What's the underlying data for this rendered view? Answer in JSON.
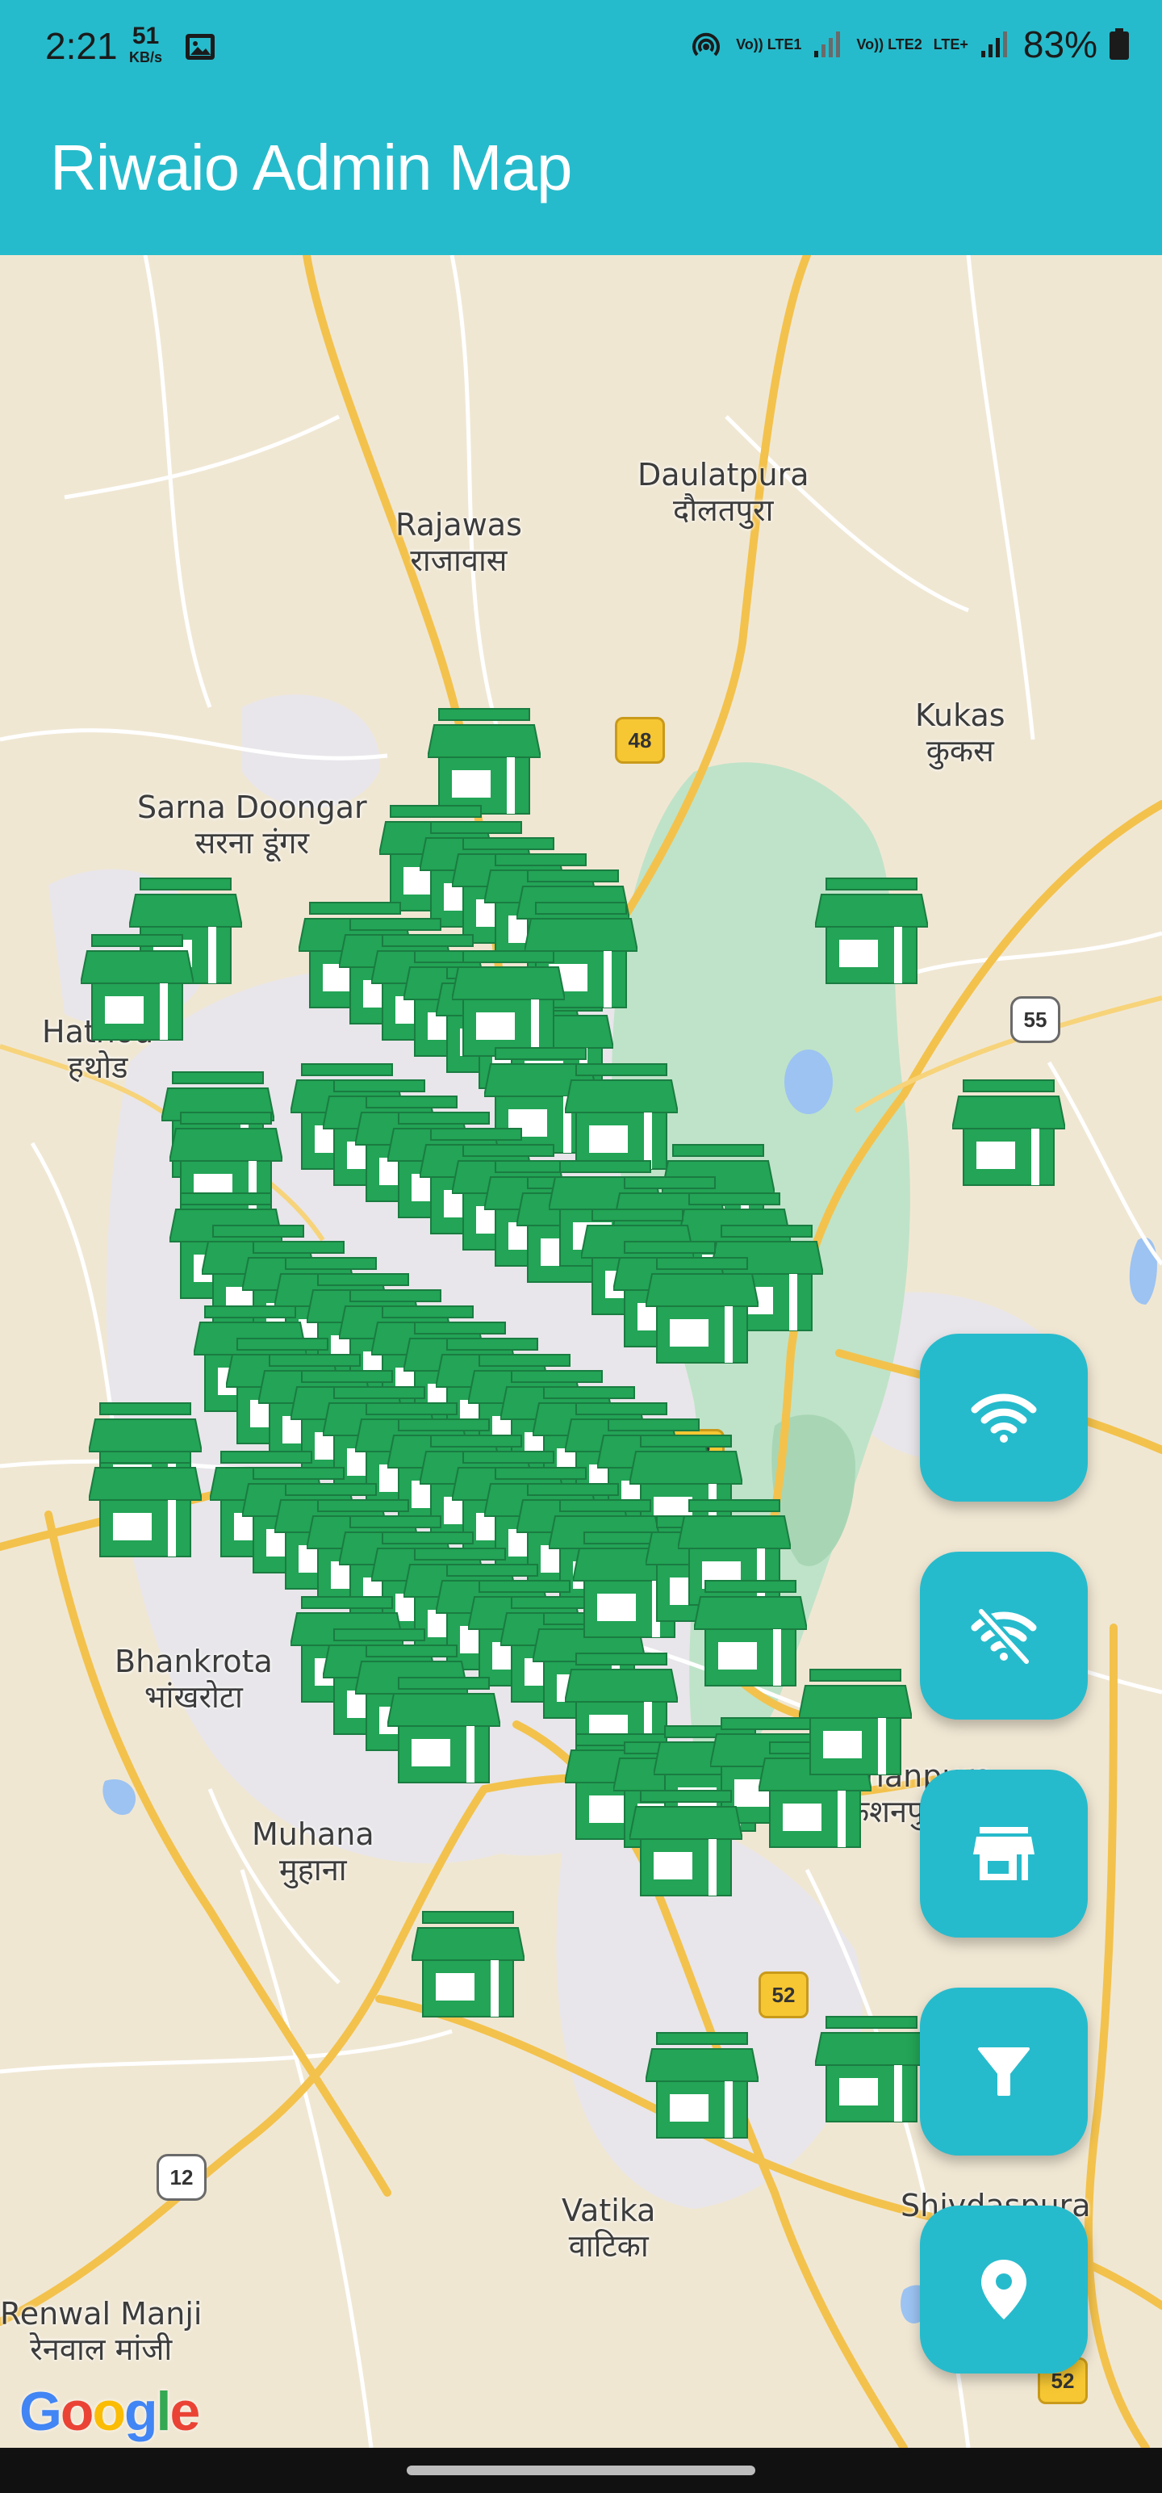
{
  "status_bar": {
    "time": "2:21",
    "speed_value": "51",
    "speed_unit": "KB/s",
    "sim1": "Vo)) LTE1",
    "sim2": "Vo)) LTE2",
    "lte_plus": "LTE+",
    "battery": "83%"
  },
  "app_bar": {
    "title": "Riwaio Admin Map"
  },
  "map": {
    "places": [
      {
        "en": "Daulatpura",
        "hi": "दौलतपुरा"
      },
      {
        "en": "Rajawas",
        "hi": "राजावास"
      },
      {
        "en": "Kukas",
        "hi": "कुकस"
      },
      {
        "en": "Sarna Doongar",
        "hi": "सरना डूंगर"
      },
      {
        "en": "Hathod",
        "hi": "हथोड"
      },
      {
        "en": "Bhankrota",
        "hi": "भांखरोटा"
      },
      {
        "en": "Muhana",
        "hi": "मुहाना"
      },
      {
        "en": "Shri Kishanpura",
        "hi": "श्री किशनपुरा"
      },
      {
        "en": "Vatika",
        "hi": "वाटिका"
      },
      {
        "en": "Shivdaspura",
        "hi": ""
      },
      {
        "en": "Renwal Manji",
        "hi": "रेनवाल मांजी"
      }
    ],
    "road_shields": [
      "48",
      "55",
      "248",
      "52",
      "12",
      "52"
    ],
    "marker_icon": "store-icon",
    "marker_color": "#23A456",
    "attribution": "Google"
  },
  "fabs": [
    {
      "icon": "wifi-icon"
    },
    {
      "icon": "wifi-off-icon"
    },
    {
      "icon": "store-icon"
    },
    {
      "icon": "filter-icon"
    },
    {
      "icon": "location-pin-icon"
    }
  ],
  "colors": {
    "accent": "#26BBCC",
    "marker": "#23A456",
    "map_bg": "#F0E7D3"
  }
}
